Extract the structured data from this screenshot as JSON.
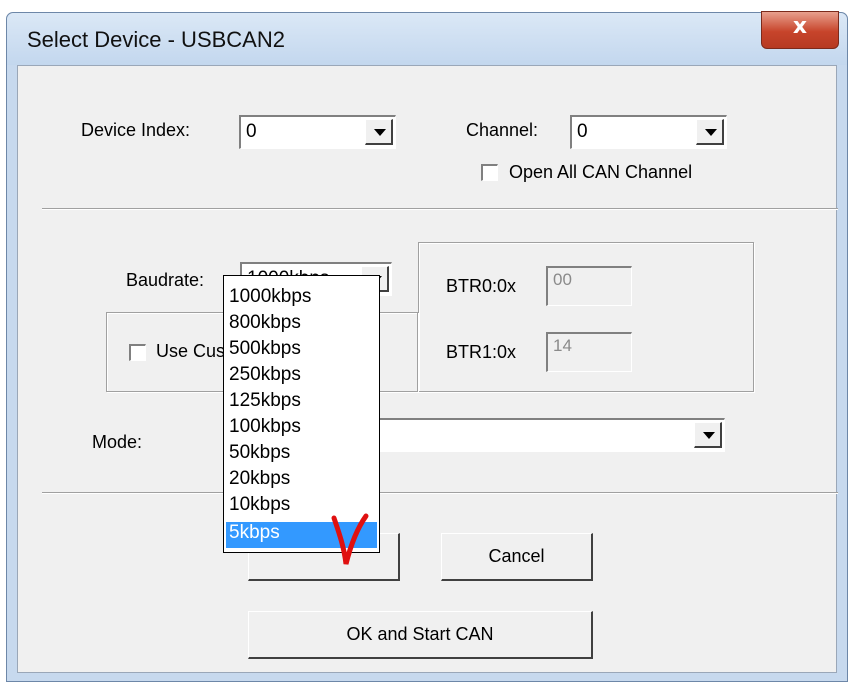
{
  "window": {
    "title": "Select Device - USBCAN2",
    "close_glyph": "x"
  },
  "device_index": {
    "label": "Device Index:",
    "value": "0"
  },
  "channel": {
    "label": "Channel:",
    "value": "0"
  },
  "open_all": {
    "label": "Open All CAN Channel",
    "checked": false
  },
  "baudrate": {
    "label": "Baudrate:",
    "value": "1000kbps"
  },
  "use_custom": {
    "label": "Use Cus",
    "checked": false
  },
  "btr0": {
    "label": "BTR0:0x",
    "value": "00"
  },
  "btr1": {
    "label": "BTR1:0x",
    "value": "14"
  },
  "mode": {
    "label": "Mode:",
    "value": ""
  },
  "buttons": {
    "cancel": "Cancel",
    "ok_start": "OK and Start CAN"
  },
  "dropdown": {
    "items": [
      "1000kbps",
      "800kbps",
      "500kbps",
      "250kbps",
      "125kbps",
      "100kbps",
      "50kbps",
      "20kbps",
      "10kbps",
      "5kbps"
    ],
    "selected": "5kbps"
  },
  "colors": {
    "selection": "#3399ff",
    "annotation": "#e01010",
    "close_button": "#c7442b"
  },
  "icons": [
    "close-icon",
    "dropdown-arrow-icon",
    "red-check-annotation"
  ]
}
